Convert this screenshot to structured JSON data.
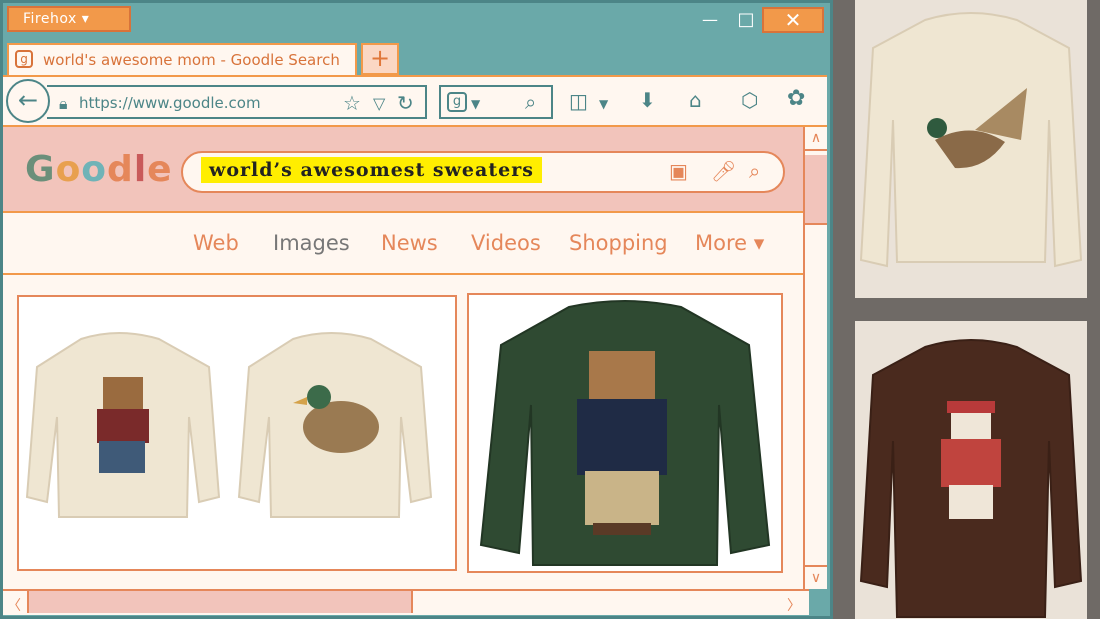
{
  "window": {
    "app_menu": "Firehox ▾",
    "minimize": "—",
    "maximize": "□",
    "close": "✕"
  },
  "tab": {
    "icon": "g",
    "title": "world's awesome mom - Goodle Search",
    "new_tab": "+"
  },
  "nav": {
    "url": "https://www.goodle.com",
    "search_engine_icon": "g"
  },
  "google": {
    "logo": [
      "G",
      "o",
      "o",
      "d",
      "l",
      "e"
    ],
    "logo_colors": [
      "#6b8f7a",
      "#e8a04f",
      "#6fb3b7",
      "#e5875a",
      "#c95a5a",
      "#e5875a"
    ],
    "query": "world’s awesomest sweaters",
    "tabs": [
      {
        "label": "Web",
        "active": false
      },
      {
        "label": "Images",
        "active": true
      },
      {
        "label": "News",
        "active": false
      },
      {
        "label": "Videos",
        "active": false
      },
      {
        "label": "Shopping",
        "active": false
      },
      {
        "label": "More ▾",
        "active": false
      }
    ]
  },
  "colors": {
    "teal": "#6aa9a9",
    "orange": "#f2994a",
    "pink": "#f2c4bb",
    "cream": "#fff7f0",
    "highlight": "#ffee00"
  }
}
